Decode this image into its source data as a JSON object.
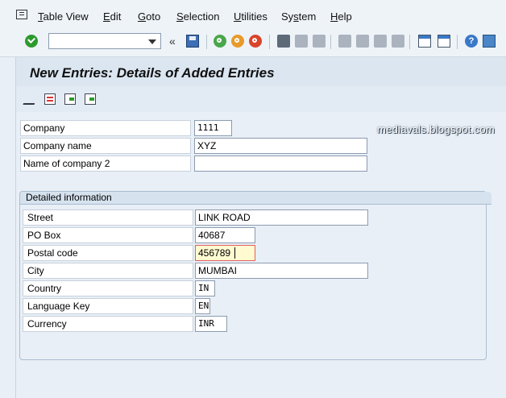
{
  "menu": {
    "items": [
      {
        "pre": "",
        "u": "T",
        "post": "able View"
      },
      {
        "pre": "",
        "u": "E",
        "post": "dit"
      },
      {
        "pre": "",
        "u": "G",
        "post": "oto"
      },
      {
        "pre": "",
        "u": "S",
        "post": "election"
      },
      {
        "pre": "",
        "u": "U",
        "post": "tilities"
      },
      {
        "pre": "Sy",
        "u": "s",
        "post": "tem"
      },
      {
        "pre": "",
        "u": "H",
        "post": "elp"
      }
    ]
  },
  "toolbar": {
    "command_value": "",
    "double_left": "«"
  },
  "page": {
    "title": "New Entries: Details of Added Entries",
    "watermark": "mediavals.blogspot.com"
  },
  "fields": {
    "company": {
      "label": "Company",
      "value": "1111"
    },
    "company_name": {
      "label": "Company name",
      "value": "XYZ"
    },
    "company2": {
      "label": "Name of company 2",
      "value": ""
    }
  },
  "group": {
    "title": "Detailed information",
    "street": {
      "label": "Street",
      "value": "LINK ROAD"
    },
    "po_box": {
      "label": "PO Box",
      "value": "40687"
    },
    "postal_code": {
      "label": "Postal code",
      "value": "456789"
    },
    "city": {
      "label": "City",
      "value": "MUMBAI"
    },
    "country": {
      "label": "Country",
      "value": "IN"
    },
    "language": {
      "label": "Language Key",
      "value": "EN"
    },
    "currency": {
      "label": "Currency",
      "value": "INR"
    }
  },
  "help_glyph": "?"
}
